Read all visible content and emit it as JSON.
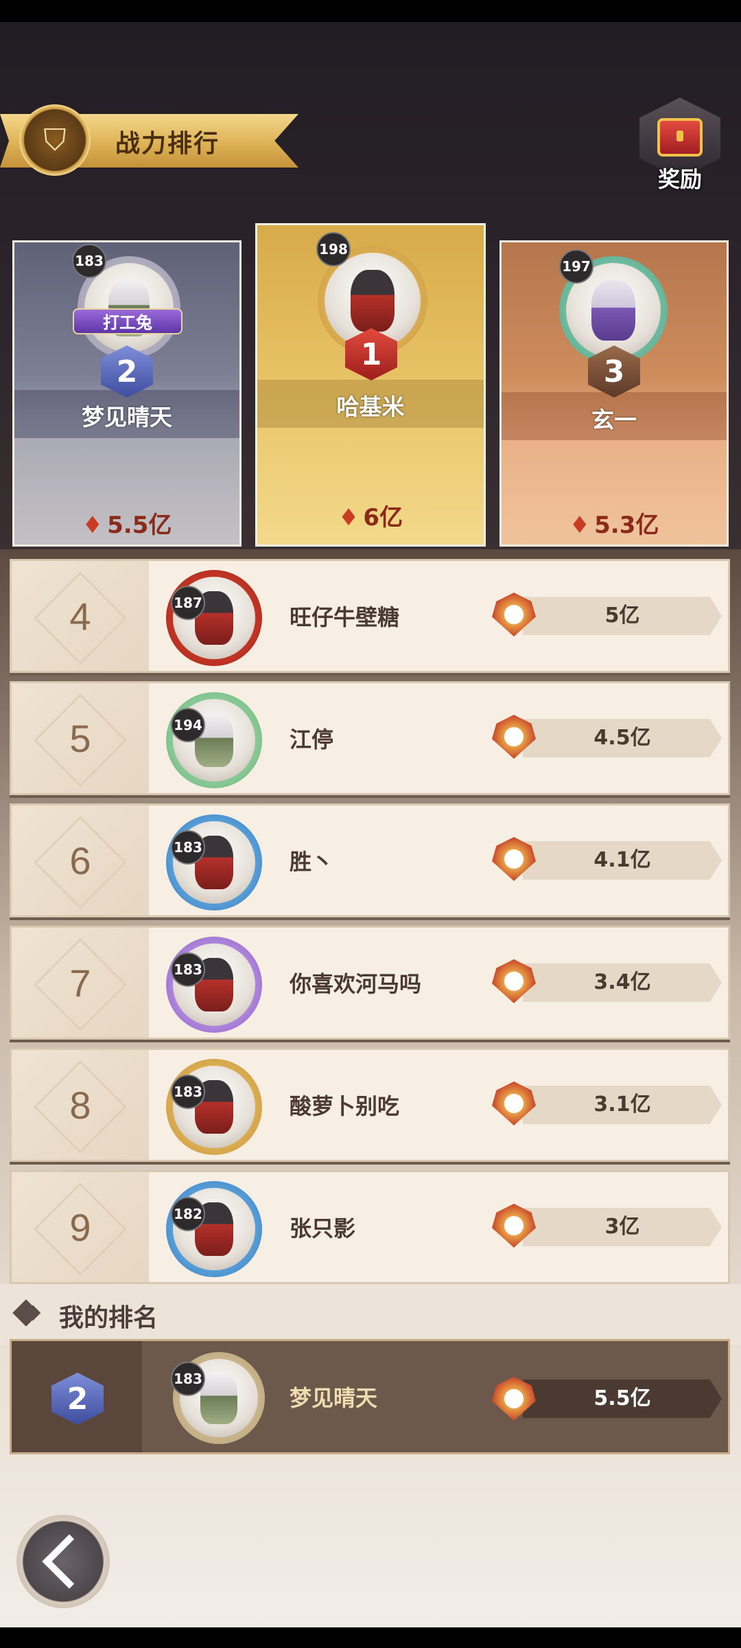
{
  "header": {
    "title": "战力排行"
  },
  "reward": {
    "label": "奖励",
    "icon": "treasure-chest-icon"
  },
  "podium": [
    {
      "rank": "2",
      "level": "183",
      "name": "梦见晴天",
      "tag": "打工兔",
      "power": "5.5亿"
    },
    {
      "rank": "1",
      "level": "198",
      "name": "哈基米",
      "power": "6亿"
    },
    {
      "rank": "3",
      "level": "197",
      "name": "玄一",
      "power": "5.3亿"
    }
  ],
  "rankings": [
    {
      "rank": "4",
      "level": "187",
      "name": "旺仔牛壁糖",
      "power": "5亿"
    },
    {
      "rank": "5",
      "level": "194",
      "name": "江停",
      "power": "4.5亿"
    },
    {
      "rank": "6",
      "level": "183",
      "name": "胜丶",
      "power": "4.1亿"
    },
    {
      "rank": "7",
      "level": "183",
      "name": "你喜欢河马吗",
      "power": "3.4亿"
    },
    {
      "rank": "8",
      "level": "183",
      "name": "酸萝卜别吃",
      "power": "3.1亿"
    },
    {
      "rank": "9",
      "level": "182",
      "name": "张只影",
      "power": "3亿"
    }
  ],
  "my_rank": {
    "header": "我的排名",
    "rank": "2",
    "level": "183",
    "name": "梦见晴天",
    "power": "5.5亿"
  },
  "colors": {
    "gold": "#e8c467",
    "silver": "#7e8096",
    "bronze": "#cf8d5d",
    "power_red": "#c8462a"
  }
}
